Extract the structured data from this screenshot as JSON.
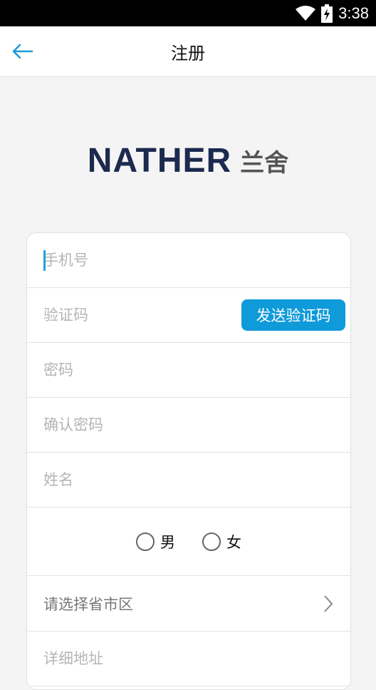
{
  "status_bar": {
    "time": "3:38"
  },
  "header": {
    "title": "注册"
  },
  "logo": {
    "brand": "NATHER",
    "brand_cn": "兰舍"
  },
  "form": {
    "phone_placeholder": "手机号",
    "code_placeholder": "验证码",
    "send_code_label": "发送验证码",
    "password_placeholder": "密码",
    "confirm_password_placeholder": "确认密码",
    "name_placeholder": "姓名",
    "gender": {
      "male_label": "男",
      "female_label": "女"
    },
    "region_select_label": "请选择省市区",
    "address_placeholder": "详细地址"
  },
  "colors": {
    "accent": "#0f9ad9",
    "brand_navy": "#1c2a4f"
  }
}
